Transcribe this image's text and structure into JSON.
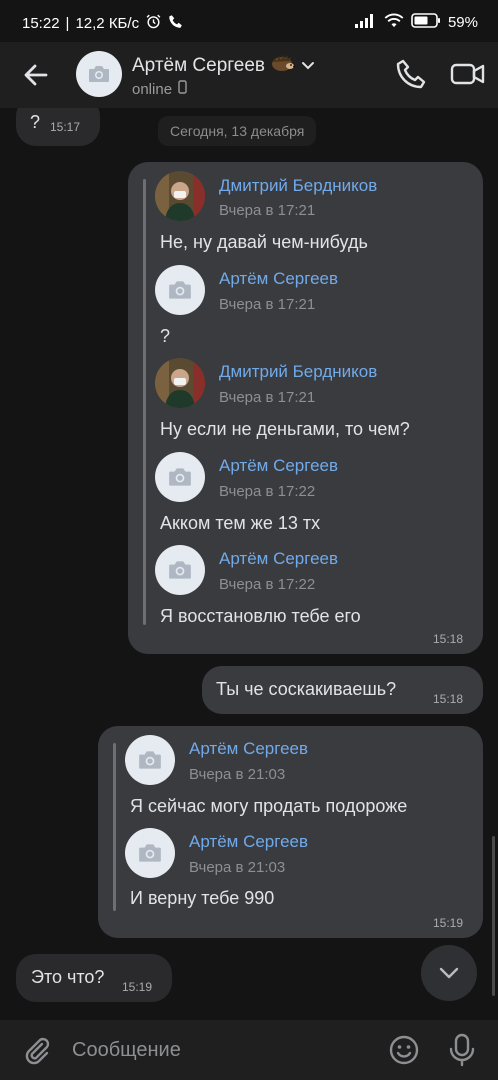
{
  "status_bar": {
    "time": "15:22",
    "speed": "12,2 КБ/с",
    "battery": "59%",
    "icons": [
      "alarm-icon",
      "call-status-icon",
      "signal-icon",
      "wifi-icon",
      "battery-icon"
    ]
  },
  "header": {
    "name": "Артём Сергеев",
    "status": "online",
    "icons": [
      "back-arrow-icon",
      "camera-placeholder-icon",
      "hedgehog-emoji-icon",
      "chevron-down-icon",
      "mobile-icon",
      "phone-icon",
      "video-camera-icon"
    ]
  },
  "chat": {
    "date_separator": "Сегодня, 13 декабря",
    "messages": [
      {
        "id": "m0",
        "direction": "incoming",
        "text": "?",
        "time": "15:17"
      },
      {
        "id": "m1",
        "direction": "outgoing",
        "time": "15:18",
        "forwarded": [
          {
            "author": "Дмитрий Бердников",
            "when": "Вчера в 17:21",
            "text": "Не, ну давай чем-нибудь",
            "avatar": "photo"
          },
          {
            "author": "Артём Сергеев",
            "when": "Вчера в 17:21",
            "text": "?",
            "avatar": "placeholder"
          },
          {
            "author": "Дмитрий Бердников",
            "when": "Вчера в 17:21",
            "text": "Ну если не деньгами, то чем?",
            "avatar": "photo"
          },
          {
            "author": "Артём Сергеев",
            "when": "Вчера в 17:22",
            "text": "Акком тем же 13 тх",
            "avatar": "placeholder"
          },
          {
            "author": "Артём Сергеев",
            "when": "Вчера в 17:22",
            "text": "Я восстановлю тебе его",
            "avatar": "placeholder"
          }
        ]
      },
      {
        "id": "m2",
        "direction": "outgoing",
        "text": "Ты че соскакиваешь?",
        "time": "15:18"
      },
      {
        "id": "m3",
        "direction": "incoming",
        "time": "15:19",
        "forwarded": [
          {
            "author": "Артём Сергеев",
            "when": "Вчера в 21:03",
            "text": "Я сейчас могу продать подороже",
            "avatar": "placeholder"
          },
          {
            "author": "Артём Сергеев",
            "when": "Вчера в 21:03",
            "text": "И верну тебе 990",
            "avatar": "placeholder"
          }
        ]
      },
      {
        "id": "m4",
        "direction": "incoming",
        "text": "Это что?",
        "time": "15:19"
      }
    ]
  },
  "composer": {
    "placeholder": "Сообщение",
    "icons": [
      "paperclip-icon",
      "emoji-icon",
      "microphone-icon",
      "scroll-down-icon"
    ]
  },
  "colors": {
    "background": "#141414",
    "bar": "#1f1f1f",
    "bubble_out": "#3a3b3e",
    "bubble_in": "#2a2a2c",
    "link": "#71aaeb",
    "text": "#e1e3e6",
    "muted": "#8d8f92"
  }
}
